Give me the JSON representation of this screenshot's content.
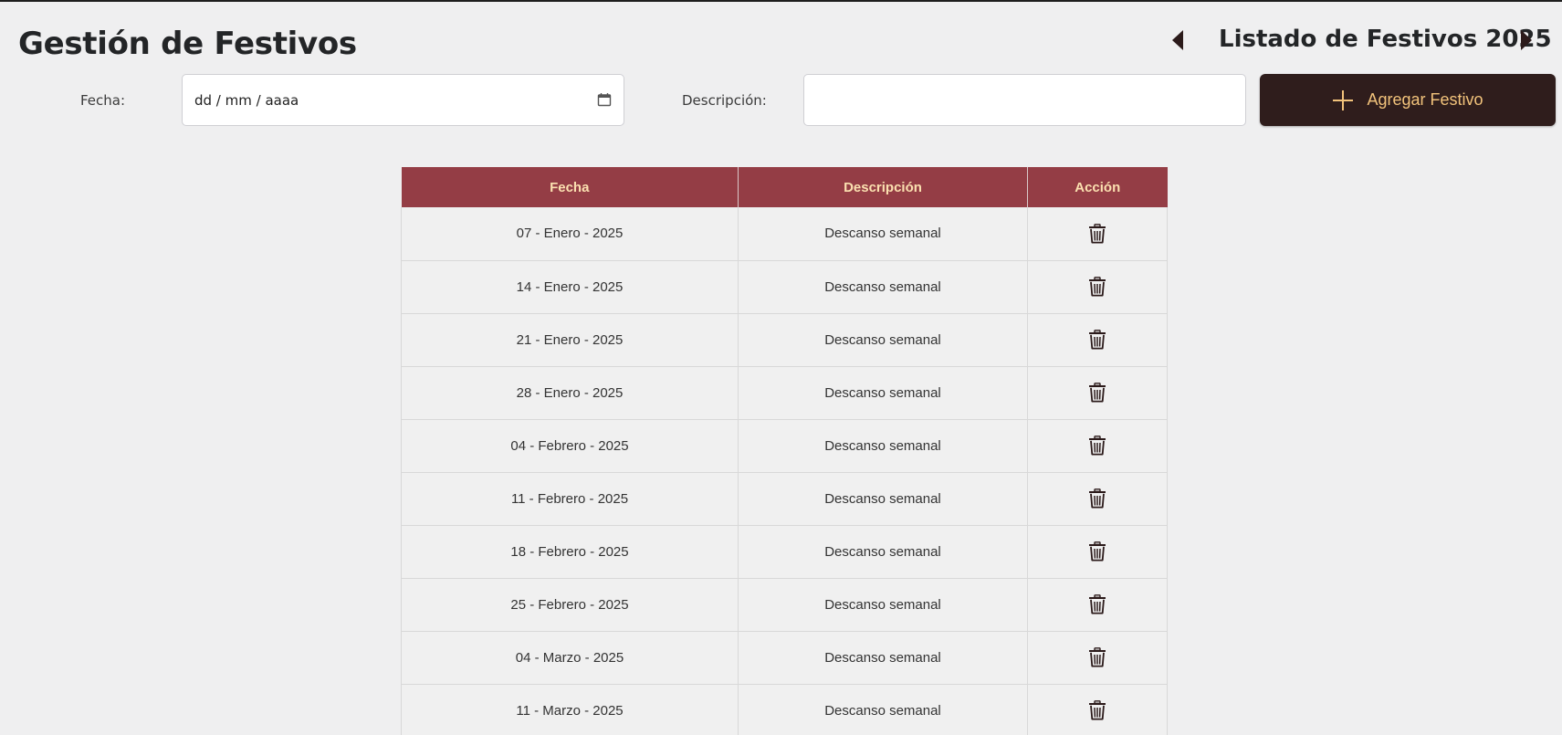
{
  "header": {
    "title": "Gestión de Festivos",
    "list_title": "Listado de Festivos 2025",
    "prev_icon": "caret-left-icon",
    "next_icon": "caret-right-icon"
  },
  "form": {
    "date_label": "Fecha:",
    "date_value": "dd / mm / aaaa",
    "date_icon": "calendar-icon",
    "description_label": "Descripción:",
    "description_value": "",
    "add_button_label": "Agregar Festivo",
    "add_button_icon": "plus-icon"
  },
  "colors": {
    "header_bg": "#943d45",
    "header_text": "#fbe0b0",
    "button_bg": "#2f1d1c",
    "button_text": "#f2c37b",
    "page_bg": "#efeff0"
  },
  "table": {
    "columns": [
      "Fecha",
      "Descripción",
      "Acción"
    ],
    "action_icon": "trash-icon",
    "rows": [
      {
        "fecha": "07 - Enero - 2025",
        "descripcion": "Descanso semanal"
      },
      {
        "fecha": "14 - Enero - 2025",
        "descripcion": "Descanso semanal"
      },
      {
        "fecha": "21 - Enero - 2025",
        "descripcion": "Descanso semanal"
      },
      {
        "fecha": "28 - Enero - 2025",
        "descripcion": "Descanso semanal"
      },
      {
        "fecha": "04 - Febrero - 2025",
        "descripcion": "Descanso semanal"
      },
      {
        "fecha": "11 - Febrero - 2025",
        "descripcion": "Descanso semanal"
      },
      {
        "fecha": "18 - Febrero - 2025",
        "descripcion": "Descanso semanal"
      },
      {
        "fecha": "25 - Febrero - 2025",
        "descripcion": "Descanso semanal"
      },
      {
        "fecha": "04 - Marzo - 2025",
        "descripcion": "Descanso semanal"
      },
      {
        "fecha": "11 - Marzo - 2025",
        "descripcion": "Descanso semanal"
      }
    ]
  }
}
